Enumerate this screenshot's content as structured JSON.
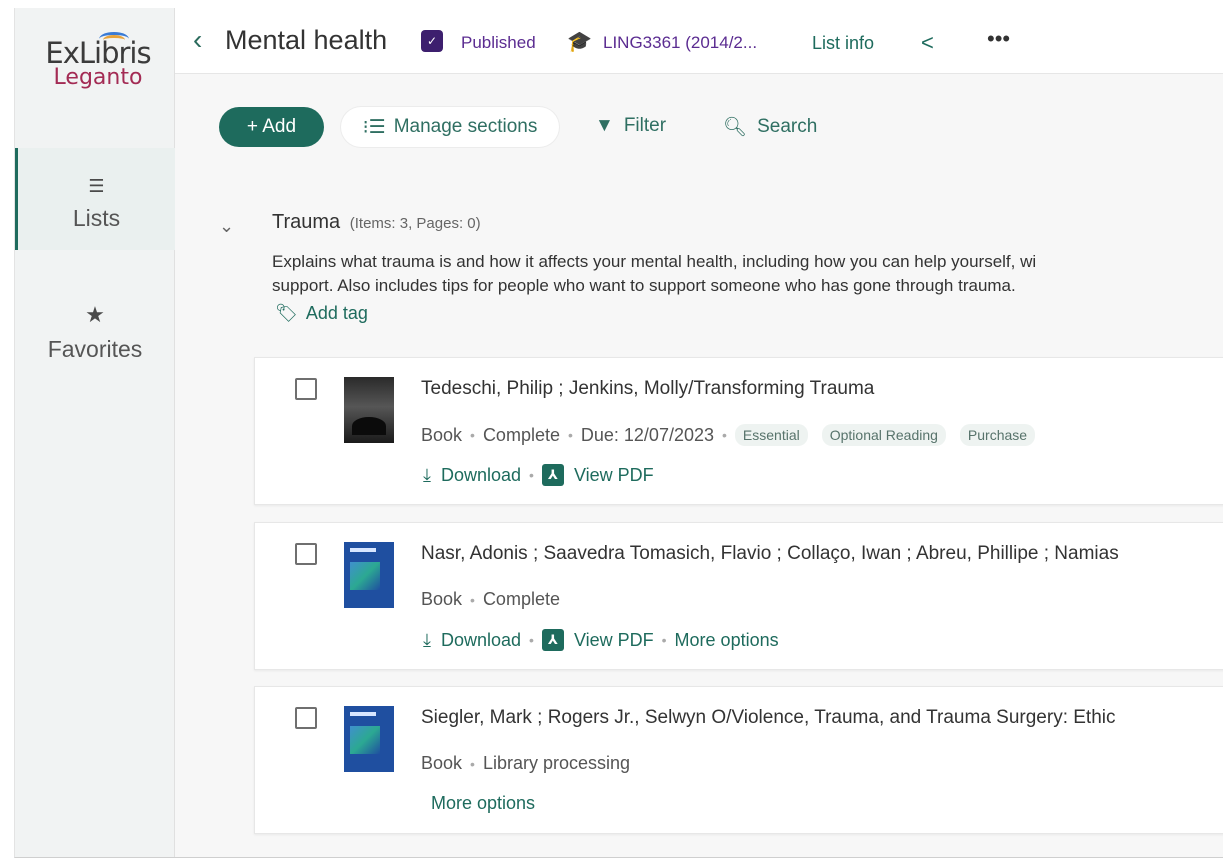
{
  "app": {
    "logo_top": "ExLibris",
    "logo_bottom": "Leganto"
  },
  "sidebar": {
    "items": [
      {
        "label": "Lists",
        "icon": "list-icon",
        "active": true
      },
      {
        "label": "Favorites",
        "icon": "star-icon",
        "active": false
      }
    ]
  },
  "header": {
    "back_glyph": "‹",
    "title": "Mental health",
    "status": "Published",
    "course": "LING3361 (2014/2...",
    "list_info": "List info",
    "share_glyph": "<",
    "more_glyph": "•••"
  },
  "toolbar": {
    "add": "+ Add",
    "manage_sections": "Manage sections",
    "filter": "Filter",
    "search": "Search"
  },
  "section": {
    "title": "Trauma",
    "meta": "(Items: 3, Pages: 0)",
    "description_line1": "Explains what trauma is and how it affects your mental health, including how you can help yourself, wi",
    "description_line2": "support. Also includes tips for people who want to support someone who has gone through trauma.",
    "add_tag": "Add tag"
  },
  "items": [
    {
      "title": "Tedeschi, Philip ; Jenkins, Molly/Transforming Trauma",
      "type": "Book",
      "status": "Complete",
      "due": "Due: 12/07/2023",
      "tags": [
        "Essential",
        "Optional Reading",
        "Purchase"
      ],
      "download": "Download",
      "view_pdf": "View PDF"
    },
    {
      "title": "Nasr, Adonis ; Saavedra Tomasich, Flavio ; Collaço, Iwan ; Abreu, Phillipe ; Namias",
      "type": "Book",
      "status": "Complete",
      "download": "Download",
      "view_pdf": "View PDF",
      "more_options": "More options"
    },
    {
      "title": "Siegler, Mark ; Rogers Jr., Selwyn O/Violence, Trauma, and Trauma Surgery: Ethic",
      "type": "Book",
      "status": "Library processing",
      "more_options": "More options"
    }
  ],
  "colors": {
    "accent": "#1e6b5d",
    "brand_purple": "#5b2c91",
    "leganto": "#a32b54"
  }
}
